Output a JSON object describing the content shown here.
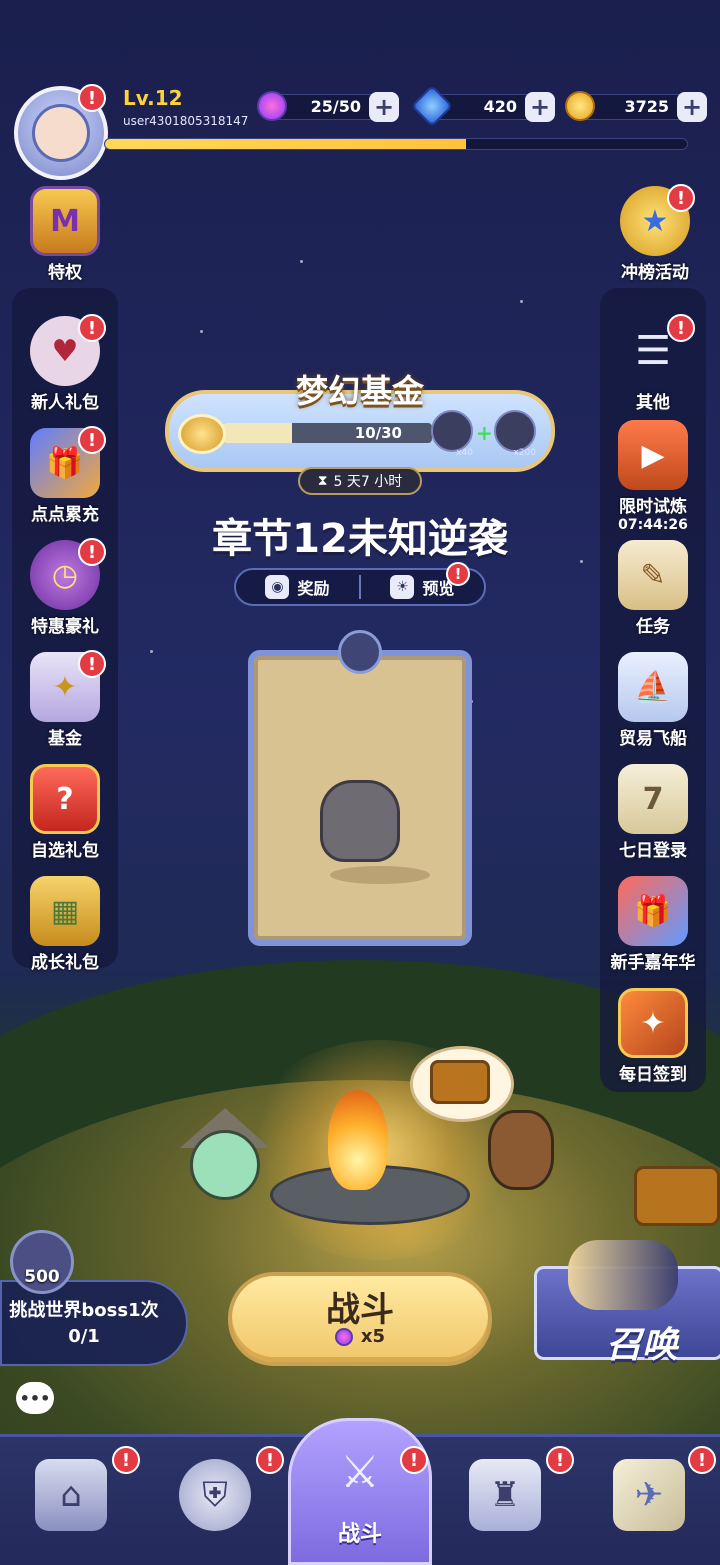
{
  "player": {
    "level": "Lv.12",
    "user_id": "user4301805318147",
    "xp_fraction": 0.62
  },
  "resources": {
    "stamina": "25/50",
    "gems": "420",
    "gold": "3725"
  },
  "left_menu": {
    "privilege": "特权",
    "items": [
      "新人礼包",
      "点点累充",
      "特惠豪礼",
      "基金",
      "自选礼包",
      "成长礼包"
    ]
  },
  "right_menu": {
    "ranking": "冲榜活动",
    "items": [
      "其他",
      "限时试炼",
      "任务",
      "贸易飞船",
      "七日登录",
      "新手嘉年华",
      "每日签到"
    ],
    "trial_timer": "07:44:26"
  },
  "fund": {
    "title": "梦幻基金",
    "progress_text": "10/30",
    "progress_fraction": 0.333,
    "reward1_count": "x40",
    "reward2_count": "x200",
    "timer": "5 天7 小时"
  },
  "chapter": {
    "title": "章节12未知逆袭",
    "reward_label": "奖励",
    "preview_label": "预览"
  },
  "boss": {
    "count": "500",
    "label": "挑战世界boss1次",
    "progress": "0/1"
  },
  "battle": {
    "label": "战斗",
    "cost": "x5"
  },
  "summon": {
    "label": "召唤"
  },
  "nav": {
    "active_label": "战斗"
  },
  "colors": {
    "accent_gold": "#ffd23c",
    "badge_red": "#e23b43",
    "nav_active": "#7d6be0"
  }
}
